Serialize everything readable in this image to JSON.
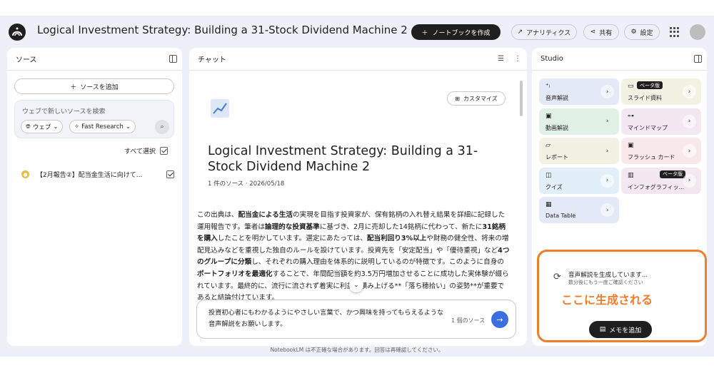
{
  "header": {
    "title": "Logical Investment Strategy: Building a 31-Stock Dividend Machine 2",
    "create_notebook": "ノートブックを作成",
    "analytics": "アナリティクス",
    "share": "共有",
    "settings": "設定"
  },
  "sources": {
    "heading": "ソース",
    "add_source": "ソースを追加",
    "search_placeholder": "ウェブで新しいソースを検索",
    "chip_web": "ウェブ",
    "chip_research": "Fast Research",
    "select_all": "すべて選択",
    "items": [
      {
        "title": "【2月報告②】配当金生活に向けて...",
        "checked": true
      }
    ]
  },
  "chat": {
    "heading": "チャット",
    "customize": "カスタマイズ",
    "notebook_title": "Logical Investment Strategy: Building a 31-Stock Dividend Machine 2",
    "meta": "1 件のソース · 2026/05/18",
    "summary": [
      {
        "text": "この出典は、",
        "bold": false
      },
      {
        "text": "配当金による生活",
        "bold": true
      },
      {
        "text": "の実現を目指す投資家が、保有銘柄の入れ替え結果を詳細に記録した運用報告です。筆者は",
        "bold": false
      },
      {
        "text": "論理的な投資基準",
        "bold": true
      },
      {
        "text": "に基づき、2月に売却した14銘柄に代わって、新たに",
        "bold": false
      },
      {
        "text": "31銘柄を購入",
        "bold": true
      },
      {
        "text": "したことを明かしています。選定にあたっては、",
        "bold": false
      },
      {
        "text": "配当利回り3%以上",
        "bold": true
      },
      {
        "text": "や財務の健全性、将来の増配見込みなどを重視した独自のルールを設けています。投資先を「安定配当」や「優待重視」など",
        "bold": false
      },
      {
        "text": "4つのグループに分類",
        "bold": true
      },
      {
        "text": "し、それぞれの購入理由を体系的に説明しているのが特徴です。このように自身の",
        "bold": false
      },
      {
        "text": "ポートフォリオを最適化",
        "bold": true
      },
      {
        "text": "することで、年間配当額を約3.5万円増加させることに成功した実体験が綴られています。最終的に、流行に流されず着実に利益を積み上げる**「落ち穂拾い」の姿勢**が重要であると結論付けています。",
        "bold": false
      }
    ],
    "input_text": "投資初心者にもわかるようにやさしい言葉で、かつ興味を持ってもらえるような音声解説をお願いします。",
    "source_count": "1 個のソース"
  },
  "studio": {
    "heading": "Studio",
    "tiles": [
      {
        "label": "音声解説",
        "icon": "audio-waves-icon",
        "color": "#e4e9f8",
        "beta": false
      },
      {
        "label": "スライド資料",
        "icon": "slides-icon",
        "color": "#f3f1e4",
        "beta": true
      },
      {
        "label": "動画解説",
        "icon": "video-icon",
        "color": "#e2f1e6",
        "beta": false
      },
      {
        "label": "マインドマップ",
        "icon": "mindmap-icon",
        "color": "#f3e7f2",
        "beta": false
      },
      {
        "label": "レポート",
        "icon": "report-icon",
        "color": "#f3f1e4",
        "beta": false
      },
      {
        "label": "フラッシュ カード",
        "icon": "flashcard-icon",
        "color": "#f8e8ea",
        "beta": false
      },
      {
        "label": "クイズ",
        "icon": "quiz-icon",
        "color": "#e2eff8",
        "beta": false
      },
      {
        "label": "インフォグラフィッ...",
        "icon": "infographic-icon",
        "color": "#f3e7f2",
        "beta": true
      },
      {
        "label": "Data Table",
        "icon": "table-icon",
        "color": "#e4e9f8",
        "beta": false
      }
    ],
    "beta_label": "ベータ版",
    "generating_title": "音声解説を生成しています...",
    "generating_sub": "数分後にもう一度ご確認ください",
    "annotation": "ここに生成される",
    "memo_button": "メモを追加"
  },
  "footer": "NotebookLM は不正確な場合があります。回答は再確認してください。",
  "colors": {
    "accent": "#3b6fe0",
    "annotation": "#ef7d2c",
    "dark": "#1f1f1f",
    "background": "#eef0f9"
  }
}
